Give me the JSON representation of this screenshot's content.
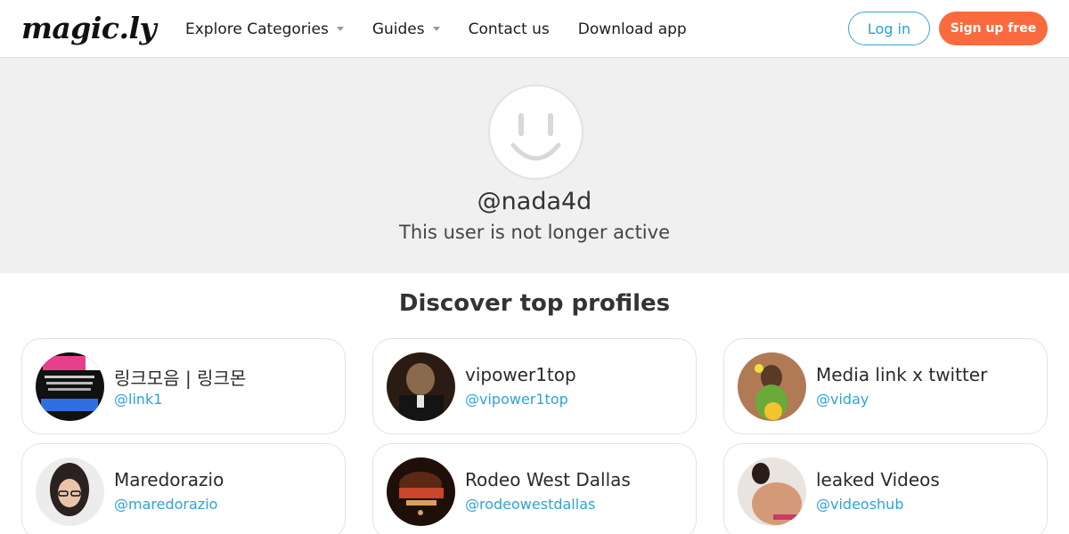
{
  "header": {
    "logo": "magic.ly",
    "nav": [
      {
        "label": "Explore Categories",
        "has_dropdown": true
      },
      {
        "label": "Guides",
        "has_dropdown": true
      },
      {
        "label": "Contact us",
        "has_dropdown": false
      },
      {
        "label": "Download app",
        "has_dropdown": false
      }
    ],
    "login_label": "Log in",
    "signup_label": "Sign up free"
  },
  "profile": {
    "avatar_icon": "smiley-face-icon",
    "username": "@nada4d",
    "status": "This user is not longer active"
  },
  "discover": {
    "title": "Discover top profiles",
    "profiles": [
      {
        "name": "링크모음 | 링크몬",
        "handle": "@link1"
      },
      {
        "name": "vipower1top",
        "handle": "@vipower1top"
      },
      {
        "name": "Media link x twitter",
        "handle": "@viday"
      },
      {
        "name": "Maredorazio",
        "handle": "@maredorazio"
      },
      {
        "name": "Rodeo West Dallas",
        "handle": "@rodeowestdallas"
      },
      {
        "name": "leaked Videos",
        "handle": "@videoshub"
      }
    ]
  },
  "colors": {
    "accent_blue": "#2ea3d6",
    "signup_orange": "#f96a3e",
    "hero_bg": "#f0f0f0"
  }
}
